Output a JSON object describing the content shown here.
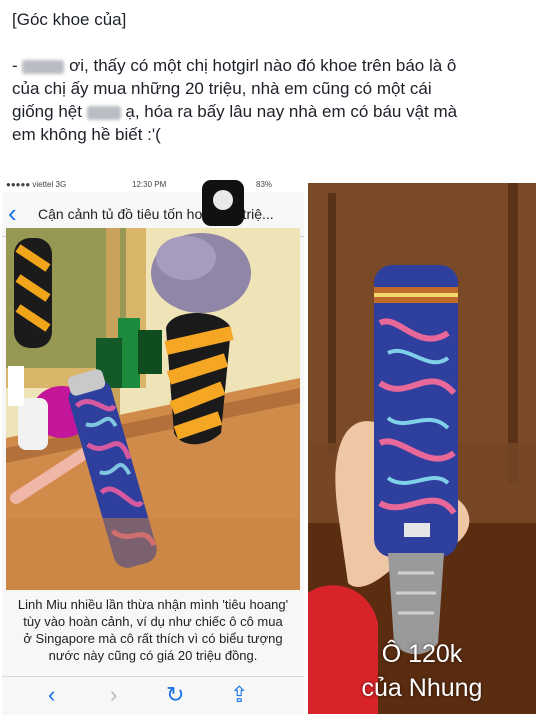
{
  "post": {
    "heading": "[Góc khoe của]",
    "line1_prefix": "- ",
    "line1_rest": " ơi, thấy có một chị hotgirl nào đó khoe trên báo là ô",
    "line2": "của chị ấy mua những 20 triệu, nhà em cũng có một cái",
    "line3_prefix": "giống hệt ",
    "line3_rest": " ạ, hóa ra bấy lâu nay nhà em có báu vật mà",
    "line4": "em không hề biết :'("
  },
  "phone": {
    "status_carrier": "●●●●● viettel 3G",
    "status_time": "12:30 PM",
    "status_battery": "83%",
    "nav_title": "Cận cảnh tủ đồ tiêu tốn hơn 800 triệ...",
    "caption_line1": "Linh Miu nhiều lần thừa nhận mình 'tiêu hoang'",
    "caption_line2": "tùy vào hoàn cảnh, ví dụ như chiếc ô cô mua",
    "caption_line3": "ở Singapore mà cô rất thích vì có biểu tượng",
    "caption_line4": "nước này cũng có giá 20 triệu đồng.",
    "toolbar": {
      "back": "‹",
      "forward": "›",
      "reload": "↻",
      "share": "⇪"
    }
  },
  "overlay": {
    "line1": "Ô 120k",
    "line2": "của Nhung"
  },
  "colors": {
    "ios_blue": "#1a73e8",
    "umbrella_blue": "#2f3f9e"
  }
}
